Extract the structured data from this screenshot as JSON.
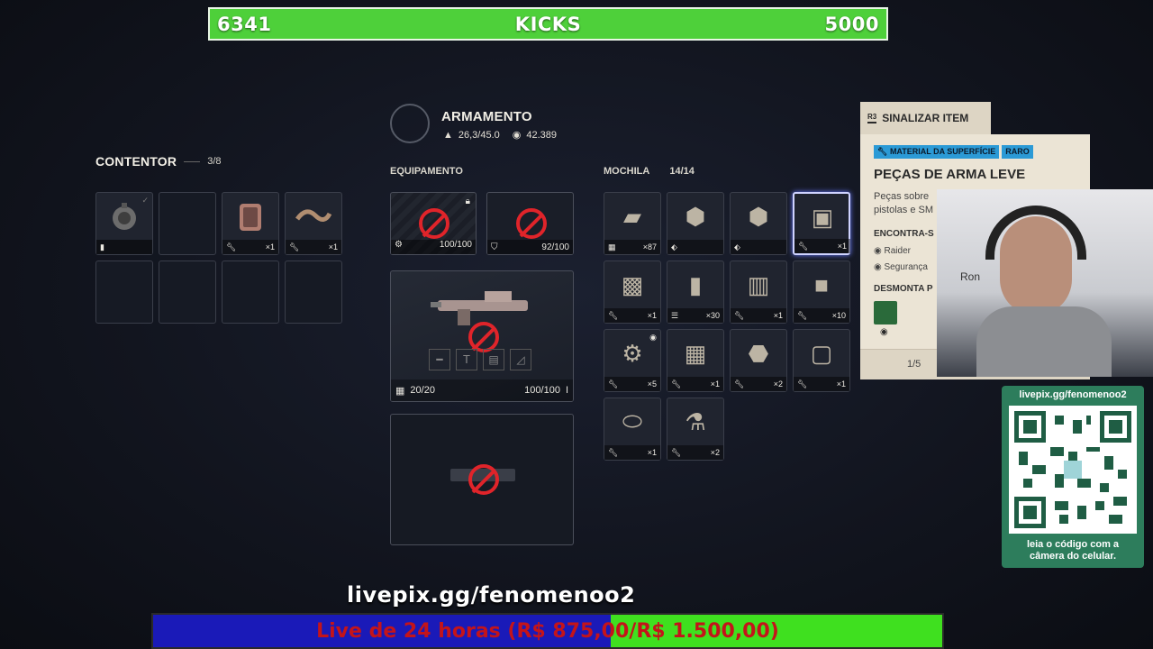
{
  "overlay": {
    "kicks_left": "6341",
    "kicks_title": "KICKS",
    "kicks_right": "5000",
    "livepix_url": "livepix.gg/fenomenoo2",
    "goal_text": "Live de 24 horas (R$ 875,00/R$ 1.500,00)",
    "qr_url": "livepix.gg/fenomenoo2",
    "qr_caption": "leia o código com a câmera do celular."
  },
  "container": {
    "title": "CONTENTOR",
    "count": "3/8",
    "slots": [
      {
        "icon": "grenade-icon",
        "qty": "",
        "rarity": "cream"
      },
      {
        "icon": "",
        "qty": "",
        "rarity": "empty"
      },
      {
        "icon": "canister-icon",
        "qty": "×1",
        "rarity": "pink"
      },
      {
        "icon": "cable-icon",
        "qty": "×1",
        "rarity": "green"
      }
    ]
  },
  "loadout": {
    "title": "ARMAMENTO",
    "weight": "26,3/45.0",
    "credits": "42.389",
    "equipment_label": "EQUIPAMENTO",
    "augment_durability": "100/100",
    "shield_durability": "92/100",
    "weapon_ammo": "20/20",
    "weapon_durability": "100/100"
  },
  "backpack": {
    "title": "MOCHILA",
    "count": "14/14",
    "items": [
      {
        "icon": "ammo-box-icon",
        "qty": "×87",
        "rarity": "none"
      },
      {
        "icon": "metal-part-icon",
        "qty": "",
        "rarity": "pink"
      },
      {
        "icon": "metal-part-icon",
        "qty": "",
        "rarity": "pink"
      },
      {
        "icon": "weapon-parts-icon",
        "qty": "×1",
        "rarity": "blue"
      },
      {
        "icon": "toolcase-icon",
        "qty": "×1",
        "rarity": "blue"
      },
      {
        "icon": "battery-pack-icon",
        "qty": "×30",
        "rarity": "none"
      },
      {
        "icon": "machine-icon",
        "qty": "×1",
        "rarity": "pink"
      },
      {
        "icon": "crate-icon",
        "qty": "×10",
        "rarity": "none"
      },
      {
        "icon": "gears-icon",
        "qty": "×5",
        "rarity": "green"
      },
      {
        "icon": "case-icon",
        "qty": "×1",
        "rarity": "pink"
      },
      {
        "icon": "scrap-icon",
        "qty": "×2",
        "rarity": "pink"
      },
      {
        "icon": "cooler-icon",
        "qty": "×1",
        "rarity": "blue"
      },
      {
        "icon": "canister-icon",
        "qty": "×1",
        "rarity": "none"
      },
      {
        "icon": "microscope-icon",
        "qty": "×2",
        "rarity": "blue"
      }
    ]
  },
  "tooltip": {
    "signal_key": "R3",
    "signal_label": "SINALIZAR ITEM",
    "category": "MATERIAL DA SUPERFÍCIE",
    "rarity": "RARO",
    "name": "PEÇAS DE ARMA LEVE",
    "description": "Peças sobre pistolas e SM",
    "found_label": "ENCONTRA-S",
    "found_1": "Raider",
    "found_2": "Segurança",
    "dismantle_label": "DESMONTA P",
    "page": "1/5"
  },
  "webcam": {
    "partial_name": "Ron"
  }
}
